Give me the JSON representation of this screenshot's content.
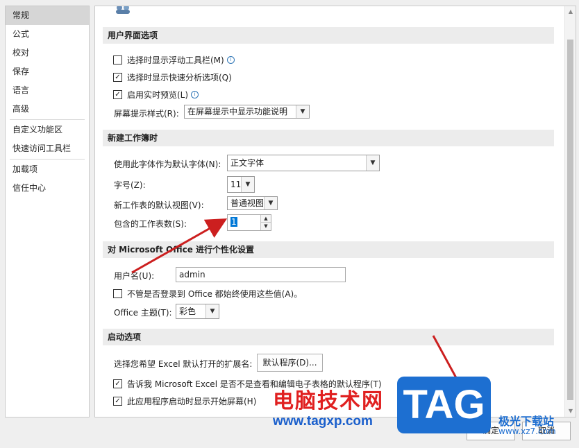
{
  "sidebar": {
    "items": [
      {
        "label": "常规",
        "selected": true
      },
      {
        "label": "公式"
      },
      {
        "label": "校对"
      },
      {
        "label": "保存"
      },
      {
        "label": "语言"
      },
      {
        "label": "高级"
      },
      {
        "label": "自定义功能区"
      },
      {
        "label": "快速访问工具栏"
      },
      {
        "label": "加载项"
      },
      {
        "label": "信任中心"
      }
    ]
  },
  "ui_options": {
    "heading": "用户界面选项",
    "mini_toolbar": {
      "label": "选择时显示浮动工具栏(M)",
      "checked": false
    },
    "quick_analysis": {
      "label": "选择时显示快速分析选项(Q)",
      "checked": true
    },
    "live_preview": {
      "label": "启用实时预览(L)",
      "checked": true
    },
    "screentip_label": "屏幕提示样式(R):",
    "screentip_value": "在屏幕提示中显示功能说明"
  },
  "new_workbook": {
    "heading": "新建工作簿时",
    "font_label": "使用此字体作为默认字体(N):",
    "font_value": "正文字体",
    "size_label": "字号(Z):",
    "size_value": "11",
    "view_label": "新工作表的默认视图(V):",
    "view_value": "普通视图",
    "sheets_label": "包含的工作表数(S):",
    "sheets_value": "1"
  },
  "personalize": {
    "heading": "对 Microsoft Office 进行个性化设置",
    "username_label": "用户名(U):",
    "username_value": "admin",
    "always_use": {
      "label": "不管是否登录到 Office 都始终使用这些值(A)。",
      "checked": false
    },
    "theme_label": "Office 主题(T):",
    "theme_value": "彩色"
  },
  "startup": {
    "heading": "启动选项",
    "ext_label": "选择您希望 Excel 默认打开的扩展名:",
    "default_programs_button": "默认程序(D)...",
    "tell_me": {
      "label": "告诉我 Microsoft Excel 是否不是查看和编辑电子表格的默认程序(T)",
      "checked": true
    },
    "show_start": {
      "label": "此应用程序启动时显示开始屏幕(H)",
      "checked": true
    }
  },
  "dialog_buttons": {
    "ok": "确定",
    "cancel": "取消"
  },
  "watermark": {
    "cn": "电脑技术网",
    "url": "www.tagxp.com",
    "tag": "TAG",
    "site_name": "极光下载站",
    "site_url": "www.xz7.com"
  },
  "colors": {
    "arrow": "#cc1f1f",
    "section_bg": "#ececec",
    "selected_nav": "#d6d6d6",
    "watermark_red": "#e02020",
    "watermark_blue": "#1d6fd1"
  }
}
